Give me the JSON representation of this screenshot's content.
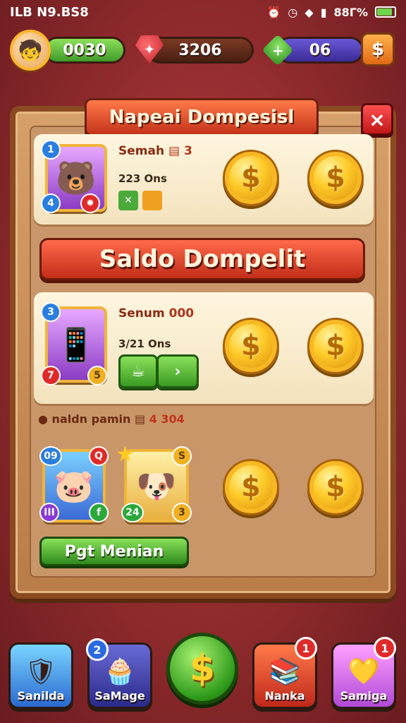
{
  "status_bar": {
    "left": "ILB N9.BS8",
    "battery": "88Г%",
    "battery_level": 0.88
  },
  "topbar": {
    "coins": "0030",
    "gems": "3206",
    "tokens": "06",
    "shop_icon": "$"
  },
  "popup": {
    "title": "Napeai Dompesisl",
    "close_icon": "×",
    "banner": "Saldo Dompelit",
    "row1": {
      "label": "Semah",
      "count": "3",
      "sub": "223 Ons",
      "badge_tl": "1",
      "badge_bl": "4"
    },
    "row2": {
      "label": "Senum",
      "count": "000",
      "sub": "3/21 Ons",
      "badge_tl": "3",
      "badge_bl": "7",
      "badge_br": "5"
    },
    "note": {
      "text": "naldn pamin",
      "count": "4 304"
    },
    "row3": {
      "badge_a": "09",
      "badge_b": "Q",
      "badge_c": "III",
      "badge_d": "f",
      "badge_e": "S",
      "badge_f": "24",
      "badge_g": "3"
    },
    "bottom_button": "Pgt Menian",
    "coin_symbol": "$"
  },
  "nav": {
    "items": [
      {
        "label": "Sanilda"
      },
      {
        "label": "SaMage",
        "badge": "2"
      },
      {
        "label": ""
      },
      {
        "label": "Nanka",
        "badge": "1"
      },
      {
        "label": "Samiga",
        "badge": "1"
      }
    ]
  }
}
